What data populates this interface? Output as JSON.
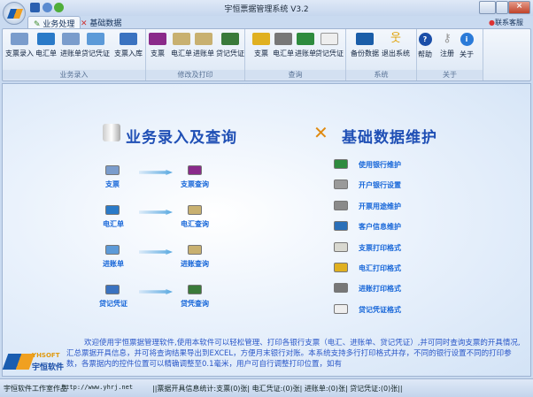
{
  "window": {
    "title": "宇恒票据管理系统 V3.2",
    "contact": "联系客服"
  },
  "tabs": [
    {
      "label": "业务处理"
    },
    {
      "label": "基础数据"
    }
  ],
  "ribbon": {
    "groups": [
      {
        "label": "业务录入",
        "buttons": [
          {
            "label": "支票录入"
          },
          {
            "label": "电汇单"
          },
          {
            "label": "进账单"
          },
          {
            "label": "贷记凭证"
          },
          {
            "label": "支票入库"
          }
        ]
      },
      {
        "label": "修改及打印",
        "buttons": [
          {
            "label": "支票"
          },
          {
            "label": "电汇单"
          },
          {
            "label": "进账单"
          },
          {
            "label": "贷记凭证"
          }
        ]
      },
      {
        "label": "查询",
        "buttons": [
          {
            "label": "支票"
          },
          {
            "label": "电汇单"
          },
          {
            "label": "进账单"
          },
          {
            "label": "贷记凭证"
          }
        ]
      },
      {
        "label": "系统",
        "buttons": [
          {
            "label": "备份数据"
          },
          {
            "label": "退出系统"
          }
        ]
      },
      {
        "label": "关于",
        "buttons": [
          {
            "label": "帮助"
          },
          {
            "label": "注册"
          },
          {
            "label": "关于"
          }
        ]
      }
    ]
  },
  "left_section": {
    "title": "业务录入及查询",
    "rows": [
      {
        "source": "支票",
        "target": "支票查询"
      },
      {
        "source": "电汇单",
        "target": "电汇查询"
      },
      {
        "source": "进账单",
        "target": "进账查询"
      },
      {
        "source": "贷记凭证",
        "target": "贷凭查询"
      }
    ]
  },
  "right_section": {
    "title": "基础数据维护",
    "items": [
      {
        "label": "使用银行维护",
        "color": "#2e8b3e"
      },
      {
        "label": "开户银行设置",
        "color": "#9a9a9a"
      },
      {
        "label": "开票用途维护",
        "color": "#8a8a8a"
      },
      {
        "label": "客户信息维护",
        "color": "#2a6fb8"
      },
      {
        "label": "支票打印格式",
        "color": "#d8d8d0"
      },
      {
        "label": "电汇打印格式",
        "color": "#e0b020"
      },
      {
        "label": "进账打印格式",
        "color": "#777777"
      },
      {
        "label": "贷记凭证格式",
        "color": "#eeeeee"
      }
    ]
  },
  "welcome": "欢迎使用宇恒票据管理软件,使用本软件可以轻松管理、打印各银行支票（电汇、进账单、贷记凭证）,并可同时查询支票的开具情况,汇总票据开具信息，并可将查询结果导出到EXCEL，方便月末银行对账。本系统支持多行打印格式并存，不同的银行设置不同的打印参数，各票据内的控件位置可以精确调整至0.1毫米，用户可自行调整打印位置，如有",
  "logo": {
    "brand": "YHSOFT",
    "name": "宇恒软件"
  },
  "status": {
    "author": "宇恒软件工作室作品",
    "url": "http://www.yhrj.net",
    "stats": "||票据开具信息统计:支票(0)张| 电汇凭证:(0)张| 进账单:(0)张| 贷记凭证:(0)张||"
  }
}
